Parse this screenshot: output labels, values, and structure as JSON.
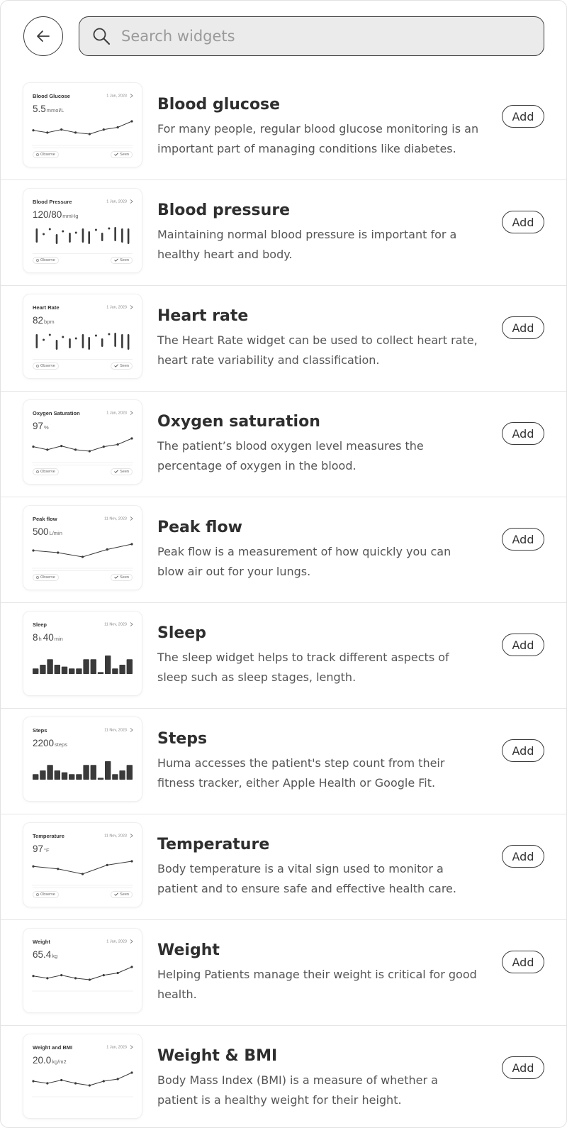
{
  "search": {
    "placeholder": "Search widgets",
    "value": ""
  },
  "icons": {
    "back": "arrow-left-icon",
    "search": "search-icon",
    "card_arrow": "chevron-right-icon",
    "seen_check": "check-icon"
  },
  "colors": {
    "border": "#3a3a3a",
    "search_bg": "#ebebeb",
    "chart": "#3a3a3a",
    "text": "#2e2e2e",
    "muted": "#555555"
  },
  "widgets": [
    {
      "name": "Blood glucose",
      "description": "For many people, regular blood glucose monitoring is an important part of managing conditions like diabetes.",
      "add_label": "Add",
      "card": {
        "title": "Blood Glucose",
        "date": "1 Jan, 2023",
        "value": "5.5",
        "unit": "mmol/L",
        "chart": "line",
        "series": [
          4.8,
          4.5,
          4.9,
          4.5,
          4.3,
          4.9,
          5.2,
          6.0
        ],
        "footer": true,
        "observe": "Observe",
        "seen": "Seen"
      }
    },
    {
      "name": "Blood pressure",
      "description": "Maintaining normal blood pressure is important for a healthy heart and body.",
      "add_label": "Add",
      "card": {
        "title": "Blood Pressure",
        "date": "1 Jan, 2023",
        "value": "120/80",
        "unit": "mmHg",
        "chart": "range",
        "footer": true,
        "observe": "Observe",
        "seen": "Seen"
      }
    },
    {
      "name": "Heart rate",
      "description": "The Heart Rate widget can be used to collect heart rate, heart rate variability and classification.",
      "add_label": "Add",
      "card": {
        "title": "Heart Rate",
        "date": "1 Jan, 2023",
        "value": "82",
        "unit": "bpm",
        "chart": "range",
        "footer": true,
        "observe": "Observe",
        "seen": "Seen"
      }
    },
    {
      "name": "Oxygen saturation",
      "description": "The patient’s blood oxygen level measures the percentage of oxygen in the blood.",
      "add_label": "Add",
      "card": {
        "title": "Oxygen Saturation",
        "date": "1 Jan, 2023",
        "value": "97",
        "unit": "%",
        "chart": "line",
        "series": [
          95.8,
          95.4,
          95.9,
          95.4,
          95.2,
          95.8,
          96.1,
          96.9
        ],
        "footer": true,
        "observe": "Observe",
        "seen": "Seen"
      }
    },
    {
      "name": "Peak flow",
      "description": "Peak flow is a measurement of how quickly you can blow air out for your lungs.",
      "add_label": "Add",
      "card": {
        "title": "Peak flow",
        "date": "11 Nov, 2023",
        "value": "500",
        "unit": "L/min",
        "chart": "line",
        "series": [
          450,
          440,
          420,
          455,
          480
        ],
        "footer": true,
        "observe": "Observe",
        "seen": "Seen"
      }
    },
    {
      "name": "Sleep",
      "description": "The sleep widget helps to track different aspects of sleep such as sleep stages, length.",
      "add_label": "Add",
      "card": {
        "title": "Sleep",
        "date": "11 Nov, 2023",
        "value": "8",
        "value_h": "h",
        "value_min": "40",
        "unit": "min",
        "chart": "bar",
        "series": [
          3,
          5,
          8,
          5,
          4,
          3,
          3,
          8,
          8,
          1,
          10,
          3,
          5,
          8
        ],
        "footer": false
      }
    },
    {
      "name": "Steps",
      "description": "Huma accesses the patient's step count from their fitness tracker, either Apple Health or Google Fit.",
      "add_label": "Add",
      "card": {
        "title": "Steps",
        "date": "11 Nov, 2023",
        "value": "2200",
        "unit": "steps",
        "chart": "bar",
        "series": [
          3,
          5,
          8,
          5,
          4,
          3,
          3,
          8,
          8,
          1,
          10,
          3,
          5,
          8
        ],
        "footer": false
      }
    },
    {
      "name": "Temperature",
      "description": "Body temperature is a vital sign used to monitor a patient and to ensure safe and effective health care.",
      "add_label": "Add",
      "card": {
        "title": "Temperature",
        "date": "11 Nov, 2023",
        "value": "97",
        "unit": "°F",
        "chart": "line",
        "series": [
          96.6,
          96.4,
          96.0,
          96.7,
          97.0
        ],
        "footer": true,
        "observe": "Observe",
        "seen": "Seen"
      }
    },
    {
      "name": "Weight",
      "description": "Helping Patients manage their weight is critical for good health.",
      "add_label": "Add",
      "card": {
        "title": "Weight",
        "date": "1 Jan, 2023",
        "value": "65.4",
        "unit": "kg",
        "chart": "line",
        "series": [
          64.8,
          64.5,
          64.9,
          64.5,
          64.3,
          64.9,
          65.2,
          66.0
        ],
        "footer": false
      }
    },
    {
      "name": "Weight & BMI",
      "description": "Body Mass Index (BMI) is a measure of whether a patient is a healthy weight for their height.",
      "add_label": "Add",
      "card": {
        "title": "Weight and BMI",
        "date": "1 Jan, 2023",
        "value": "20.0",
        "unit": "kg/m2",
        "chart": "line",
        "series": [
          19.6,
          19.4,
          19.7,
          19.4,
          19.2,
          19.6,
          19.8,
          20.4
        ],
        "footer": false
      }
    }
  ]
}
